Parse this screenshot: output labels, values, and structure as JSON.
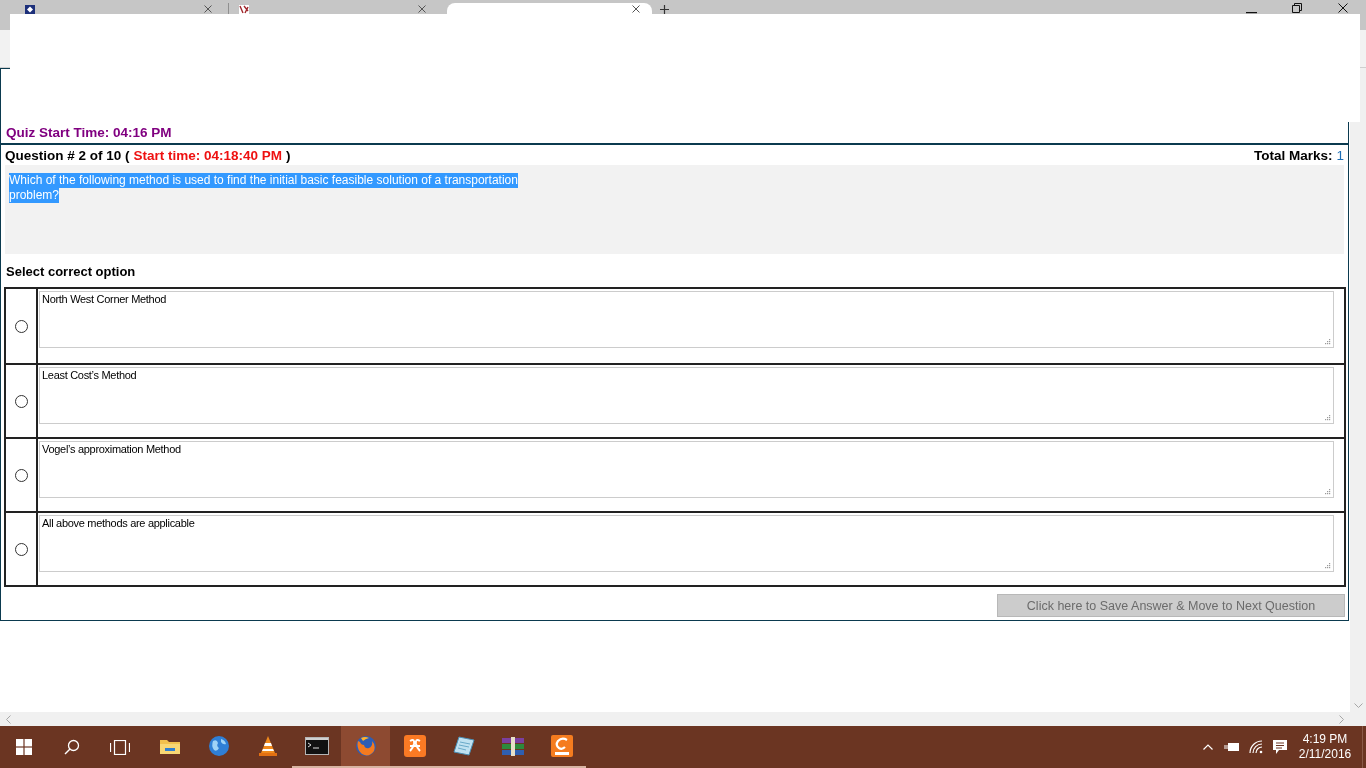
{
  "browser": {
    "tabs": [
      {
        "kind": "vu",
        "selected": false
      },
      {
        "kind": "lms",
        "selected": false
      },
      {
        "kind": "blank",
        "selected": true
      }
    ]
  },
  "quiz": {
    "start_time": "Quiz Start Time: 04:16 PM",
    "question_label": "Question # 2 of 10 (",
    "question_start_time": "Start time: 04:18:40 PM",
    "question_label_end": ")",
    "total_marks_label": "Total Marks:",
    "total_marks": "1",
    "question_text": {
      "lines": [
        "Which of the following method is used to find the initial basic feasible solution of a transportation",
        "problem?"
      ],
      "highlighted": true
    },
    "options_heading": "Select correct option",
    "options": [
      {
        "text": "North West Corner Method",
        "selected": false
      },
      {
        "text": "Least Cost’s Method",
        "selected": false
      },
      {
        "text": "Vogel’s approximation Method",
        "selected": false
      },
      {
        "text": "All above methods are applicable",
        "selected": false
      }
    ],
    "next_button": {
      "label": "Click here to Save Answer & Move to Next Question",
      "disabled": true
    }
  },
  "taskbar": {
    "apps": [
      {
        "kind": "folder",
        "running": false,
        "active": false
      },
      {
        "kind": "globe",
        "running": false,
        "active": false
      },
      {
        "kind": "cone",
        "running": false,
        "active": false
      },
      {
        "kind": "terminal",
        "running": true,
        "active": false
      },
      {
        "kind": "firefox",
        "running": true,
        "active": true
      },
      {
        "kind": "xampp",
        "running": true,
        "active": false
      },
      {
        "kind": "notepad",
        "running": true,
        "active": false
      },
      {
        "kind": "archive",
        "running": true,
        "active": false
      },
      {
        "kind": "pdf",
        "running": true,
        "active": false
      }
    ],
    "clock": {
      "time": "4:19 PM",
      "date": "2/11/2016"
    }
  }
}
